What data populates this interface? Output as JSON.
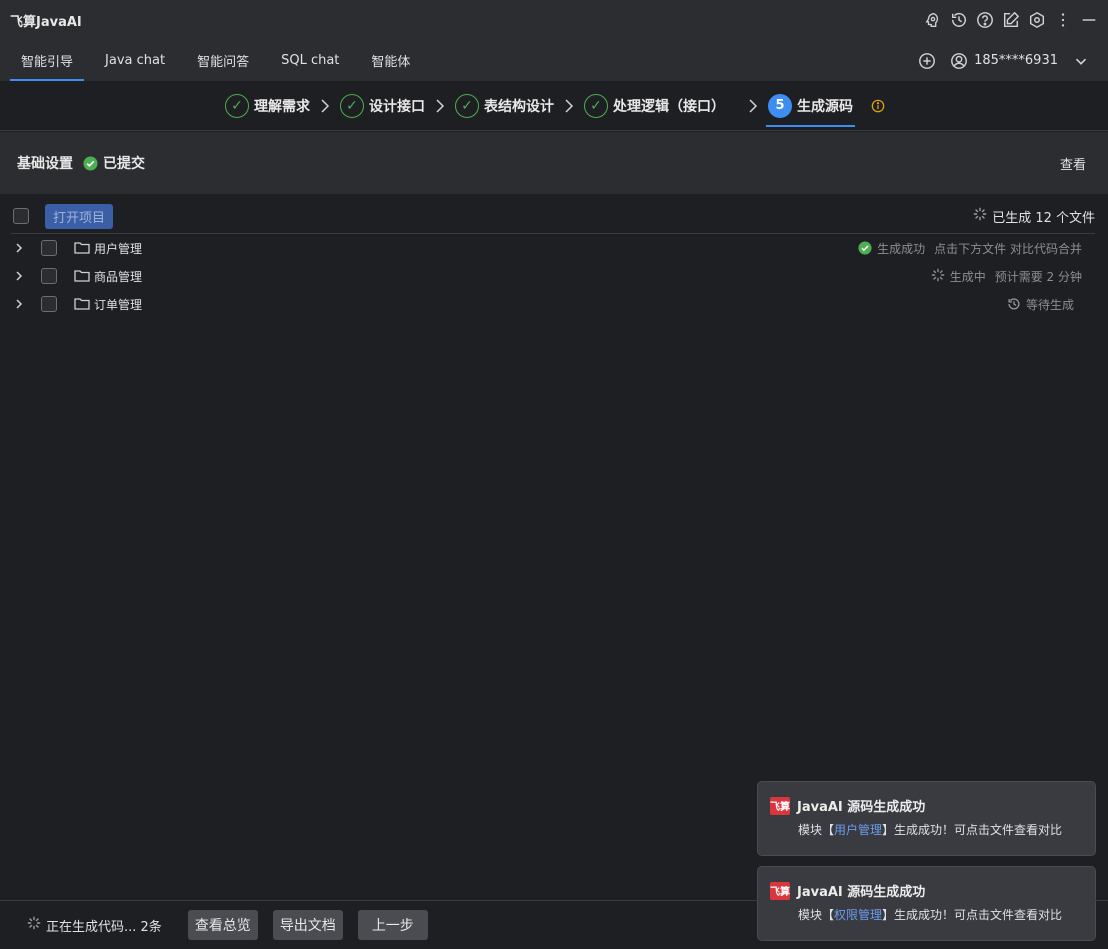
{
  "window": {
    "title": "飞算JavaAI"
  },
  "tabs": [
    {
      "label": "智能引导",
      "active": true
    },
    {
      "label": "Java chat"
    },
    {
      "label": "智能问答"
    },
    {
      "label": "SQL chat"
    },
    {
      "label": "智能体"
    }
  ],
  "user": {
    "name": "185****6931"
  },
  "steps": [
    {
      "label": "理解需求",
      "state": "done"
    },
    {
      "label": "设计接口",
      "state": "done"
    },
    {
      "label": "表结构设计",
      "state": "done"
    },
    {
      "label": "处理逻辑（接口）",
      "state": "done"
    },
    {
      "number": "5",
      "label": "生成源码",
      "state": "current"
    }
  ],
  "settings": {
    "title": "基础设置",
    "status": "已提交",
    "view_label": "查看"
  },
  "toolbar": {
    "open_project": "打开项目",
    "generated": "已生成 12 个文件"
  },
  "modules": [
    {
      "name": "用户管理",
      "status": "生成成功",
      "hint": "点击下方文件 对比代码合并"
    },
    {
      "name": "商品管理",
      "status": "生成中",
      "hint": "预计需要 2 分钟"
    },
    {
      "name": "订单管理",
      "status": "等待生成",
      "hint": ""
    }
  ],
  "notifications": [
    {
      "logo": "飞算",
      "title": "JavaAI 源码生成成功",
      "prefix": "模块【",
      "module": "用户管理",
      "suffix": "】生成成功！可点击文件查看对比"
    },
    {
      "logo": "飞算",
      "title": "JavaAI 源码生成成功",
      "prefix": "模块【",
      "module": "权限管理",
      "suffix": "】生成成功！可点击文件查看对比"
    }
  ],
  "bottom": {
    "progress": "正在生成代码... 2条",
    "overview": "查看总览",
    "export": "导出文档",
    "prev": "上一步"
  },
  "colors": {
    "accent": "#3d8ef0",
    "success": "#4caf50",
    "warning": "#e5a50a",
    "brand": "#d9363e"
  }
}
